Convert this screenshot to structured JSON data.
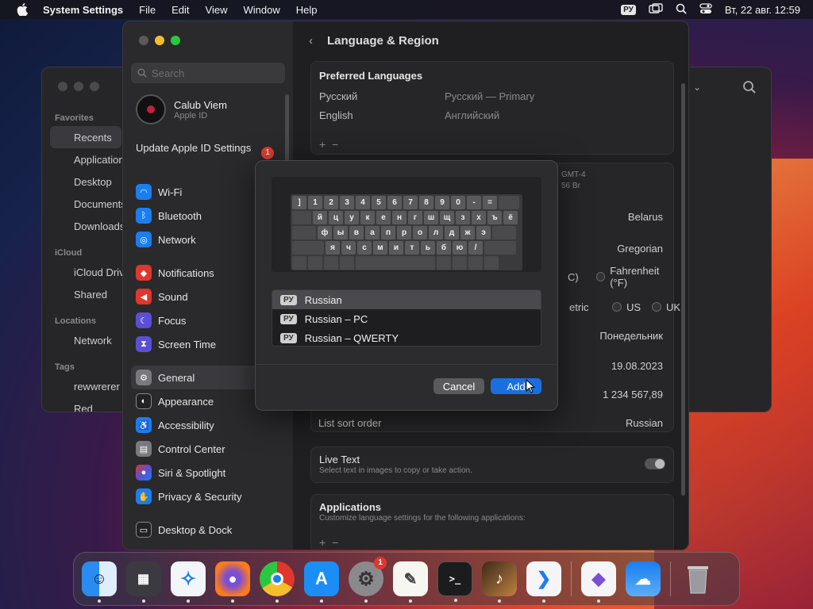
{
  "menubar": {
    "app_name": "System Settings",
    "menus": [
      "File",
      "Edit",
      "View",
      "Window",
      "Help"
    ],
    "input_source": "РУ",
    "datetime": "Вт, 22 авг. 12:59"
  },
  "finder": {
    "favorites_heading": "Favorites",
    "favorites": [
      "Recents",
      "Applications",
      "Desktop",
      "Documents",
      "Downloads"
    ],
    "icloud_heading": "iCloud",
    "icloud": [
      "iCloud Drive",
      "Shared"
    ],
    "locations_heading": "Locations",
    "locations": [
      "Network"
    ],
    "tags_heading": "Tags",
    "tags": [
      "rewwrerer",
      "Red"
    ]
  },
  "settings": {
    "search_placeholder": "Search",
    "account": {
      "name": "Calub Viem",
      "sub": "Apple ID"
    },
    "update": {
      "label": "Update Apple ID Settings",
      "badge": "1"
    },
    "sidebar_groups": [
      [
        "Wi-Fi",
        "Bluetooth",
        "Network"
      ],
      [
        "Notifications",
        "Sound",
        "Focus",
        "Screen Time"
      ],
      [
        "General",
        "Appearance",
        "Accessibility",
        "Control Center",
        "Siri & Spotlight",
        "Privacy & Security"
      ],
      [
        "Desktop & Dock"
      ]
    ],
    "page_title": "Language & Region",
    "preferred_title": "Preferred Languages",
    "languages": [
      {
        "name": "Русский",
        "value": "Русский — Primary"
      },
      {
        "name": "English",
        "value": "Английский"
      }
    ],
    "timezone_partial": [
      "GMT-4",
      "56 Br"
    ],
    "region": "Belarus",
    "calendar": "Gregorian",
    "temperature_c_partial": "C)",
    "temperature_f": "Fahrenheit (°F)",
    "measurement_metric_partial": "etric",
    "measurement_us": "US",
    "measurement_uk": "UK",
    "first_day": "Понедельник",
    "date_format": "19.08.2023",
    "number_format": "1 234 567,89",
    "list_sort_label": "List sort order",
    "list_sort_value": "Russian",
    "live_text_title": "Live Text",
    "live_text_desc": "Select text in images to copy or take action.",
    "applications_title": "Applications",
    "applications_desc": "Customize language settings for the following applications:"
  },
  "modal": {
    "keyboard_rows": [
      [
        "]",
        "1",
        "2",
        "3",
        "4",
        "5",
        "6",
        "7",
        "8",
        "9",
        "0",
        "-",
        "="
      ],
      [
        "й",
        "ц",
        "у",
        "к",
        "е",
        "н",
        "г",
        "ш",
        "щ",
        "з",
        "х",
        "ъ",
        "ё"
      ],
      [
        "ф",
        "ы",
        "в",
        "а",
        "п",
        "р",
        "о",
        "л",
        "д",
        "ж",
        "э"
      ],
      [
        "я",
        "ч",
        "с",
        "м",
        "и",
        "т",
        "ь",
        "б",
        "ю",
        "/"
      ]
    ],
    "layouts": [
      {
        "tag": "РУ",
        "name": "Russian"
      },
      {
        "tag": "РУ",
        "name": "Russian – PC"
      },
      {
        "tag": "РУ",
        "name": "Russian – QWERTY"
      }
    ],
    "cancel_label": "Cancel",
    "add_label": "Add"
  },
  "dock": {
    "apps": [
      "finder",
      "launchpad",
      "safari",
      "firefox",
      "chrome",
      "app-store",
      "system-settings",
      "textedit",
      "terminal",
      "instruments",
      "vscode",
      "visual-studio",
      "weather",
      "trash"
    ],
    "settings_badge": "1"
  }
}
